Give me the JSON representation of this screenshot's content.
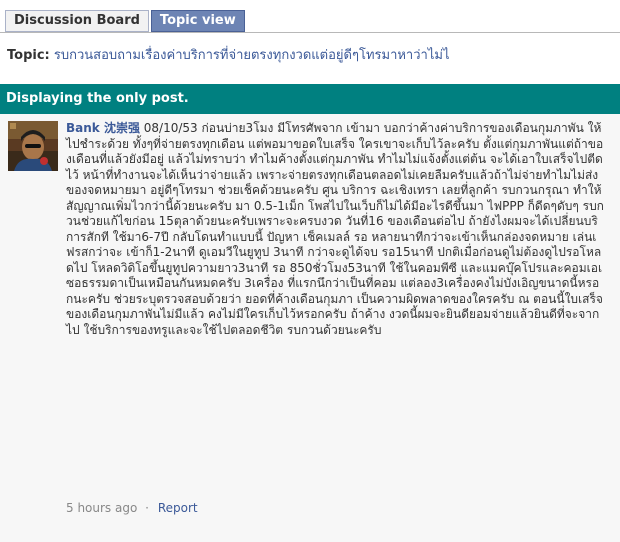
{
  "tabs": [
    {
      "label": "Discussion Board",
      "active": false
    },
    {
      "label": "Topic view",
      "active": true
    }
  ],
  "topic": {
    "label": "Topic:",
    "title": "รบกวนสอบถามเรื่องค่าบริการที่จ่ายตรงทุกงวดแต่อยู่ดีๆโทรมาหาว่าไม่ไ"
  },
  "banner": {
    "text": "Displaying the only post."
  },
  "post": {
    "author": "Bank 沈崇强",
    "body": "08/10/53 ก่อนบ่าย3โมง มีโทรศัพจาก        เข้ามา บอกว่าค้างค่าบริการของเดือนกุมภาพัน ให้ไปชำระด้วย ทั้งๆที่จ่ายตรงทุกเดือน แต่พอมาขอดใบเสร็จ ใครเขาจะเก็บไว้ละครับ ตั้งแต่กุมภาพันแต่ถ้าของเดือนที่แล้วยังมีอยู่ แล้วไม่ทราบว่า ทำไมค้างตั้งแต่กุมภาพัน ทำไมไม่แจ้งตั้งแต่ต้น จะได้เอาใบเสร็จไปตีดไว้ หน้าที่ทำงานจะได้เห็นว่าจ่ายแล้ว เพราะจ่ายตรงทุกเดือนตลอดไม่เคยลืมครับแล้วถ้าไม่จ่ายทำไมไม่ส่งของจดหมายมา อยู่ดีๆโทรมา ช่วยเช็คด้วยนะครับ ศูน บริการ ฉะเชิงเทรา เลยที่ลูกค้า              รบกวนกรุณา ทำให้สัญญาณเพิ่มไวกว่านี้ด้วยนะครับ มา 0.5-1เม็ก โพสไปในเว็บก็ไม่ได้มีอะไรดีขึ้นมา ไฟPPP ก็ดีดๆดับๆ รบกวนช่วยแก้ไขก่อน 15ตุลาด้วยนะครับเพราะจะครบงวด วันที่16 ของเดือนต่อไป ถ้ายังไงผมจะได้เปลี่ยนบริการสักที ใช้มา6-7ปี กลับโดนทำแบบนี้ ปัญหา เช็คเมลล์ รอ หลายนาทีกว่าจะเข้าเห็นกล่องจดหมาย เล่นเฟรสกว่าจะ เข้าก็1-2นาที ดูเอมวีในยูทูป 3นาที กว่าจะดูได้จบ รอ15นาที ปกติเมื่อก่อนดูไม่ต้องดูไปรอโหลดไป โหลดวิดิโอขึ้นยูทูปความยาว3นาที รอ 850ชั่วโมง53นาที ใช้ในคอมพีซี และแมคบุ๊คโปรและคอมเอเซอธรรมดาเป็นเหมือนกันหมดครับ 3เครื่อง ที่แรกนึกว่าเป็นที่คอม แต่ลอง3เครื่องคงไม่บังเอิญขนาดนี้หรอกนะครับ ช่วยระบุตรวจสอบด้วยว่า ยอดที่ค้างเดือนกุมภา เป็นความผิดพลาดของใครครับ ณ ตอนนี้ใบเสร็จของเดือนกุมภาพันไม่มีแล้ว คงไม่มีใครเก็บไว้หรอกครับ ถ้าค้าง งวดนี้ผมจะยินดียอมจ่ายแล้วยินดีที่จะจากไป ใช้บริการของทรูและจะใช้ไปตลอดชีวิต รบกวนด้วยนะครับ",
    "timestamp": "5 hours ago",
    "separator": "·",
    "report_label": "Report"
  },
  "colors": {
    "link": "#3b5998",
    "banner_bg": "#008080",
    "active_tab_bg": "#6d84b4",
    "post_bg": "#f7f7f7"
  }
}
